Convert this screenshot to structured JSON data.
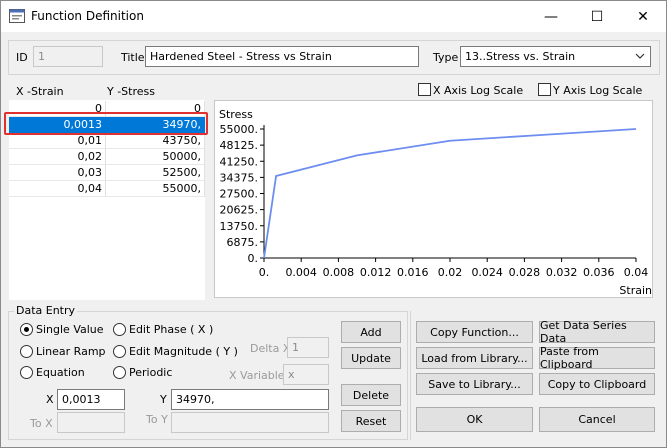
{
  "window": {
    "title": "Function Definition",
    "minimize": "—",
    "maximize": "☐",
    "close": "✕"
  },
  "header": {
    "id_label": "ID",
    "id_value": "1",
    "title_label": "Title",
    "title_value": "Hardened Steel - Stress vs Strain",
    "type_label": "Type",
    "type_value": "13..Stress vs. Strain"
  },
  "table": {
    "col_x": "X -Strain",
    "col_y": "Y -Stress",
    "rows": [
      {
        "x": "0",
        "y": "0"
      },
      {
        "x": "0,0013",
        "y": "34970,"
      },
      {
        "x": "0,01",
        "y": "43750,"
      },
      {
        "x": "0,02",
        "y": "50000,"
      },
      {
        "x": "0,03",
        "y": "52500,"
      },
      {
        "x": "0,04",
        "y": "55000,"
      }
    ],
    "selected_row": 1
  },
  "options": {
    "x_log": "X Axis Log Scale",
    "y_log": "Y Axis Log Scale"
  },
  "chart_data": {
    "type": "line",
    "ylabel": "Stress",
    "xlabel": "Strain",
    "x": [
      0,
      0.0013,
      0.01,
      0.02,
      0.03,
      0.04
    ],
    "y": [
      0,
      34970,
      43750,
      50000,
      52500,
      55000
    ],
    "xlim": [
      0,
      0.04
    ],
    "ylim": [
      0,
      55000
    ],
    "xticks": [
      "0.",
      "0.004",
      "0.008",
      "0.012",
      "0.016",
      "0.02",
      "0.024",
      "0.028",
      "0.032",
      "0.036",
      "0.04"
    ],
    "yticks": [
      "55000.",
      "48125.",
      "41250.",
      "34375.",
      "27500.",
      "20625.",
      "13750.",
      "6875.",
      "0."
    ],
    "line_color": "#6d8ef0"
  },
  "entry": {
    "group_label": "Data Entry",
    "single": "Single Value",
    "linear": "Linear Ramp",
    "equation": "Equation",
    "phase": "Edit Phase ( X )",
    "magnitude": "Edit Magnitude ( Y )",
    "periodic": "Periodic",
    "delta_label": "Delta X",
    "delta_value": "1",
    "xvar_label": "X Variable",
    "xvar_value": "x",
    "x_label": "X",
    "x_value": "0,0013",
    "y_label": "Y",
    "y_value": "34970,",
    "tox_label": "To X",
    "toy_label": "To Y",
    "add": "Add",
    "update": "Update",
    "delete": "Delete",
    "reset": "Reset"
  },
  "actions": {
    "copy_function": "Copy Function...",
    "get_series": "Get Data Series Data",
    "load_library": "Load from Library...",
    "paste_clipboard": "Paste from Clipboard",
    "save_library": "Save to Library...",
    "copy_clipboard": "Copy to Clipboard",
    "ok": "OK",
    "cancel": "Cancel"
  }
}
